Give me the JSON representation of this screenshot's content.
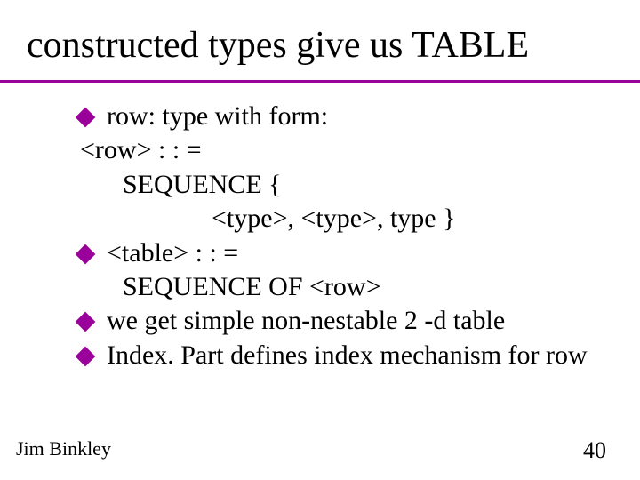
{
  "title": "constructed types give us TABLE",
  "bullets": {
    "b1": {
      "lead": "row: type with form:",
      "l1": "<row> : : =",
      "l2": "SEQUENCE {",
      "l3": "<type>, <type>, type }"
    },
    "b2": {
      "lead": "<table> : : =",
      "l1": "SEQUENCE OF <row>"
    },
    "b3": "we get simple non-nestable 2 -d table",
    "b4": "Index. Part defines index mechanism for row"
  },
  "footer": {
    "left": "Jim Binkley",
    "right": "40"
  },
  "accent_color": "#9a009a"
}
